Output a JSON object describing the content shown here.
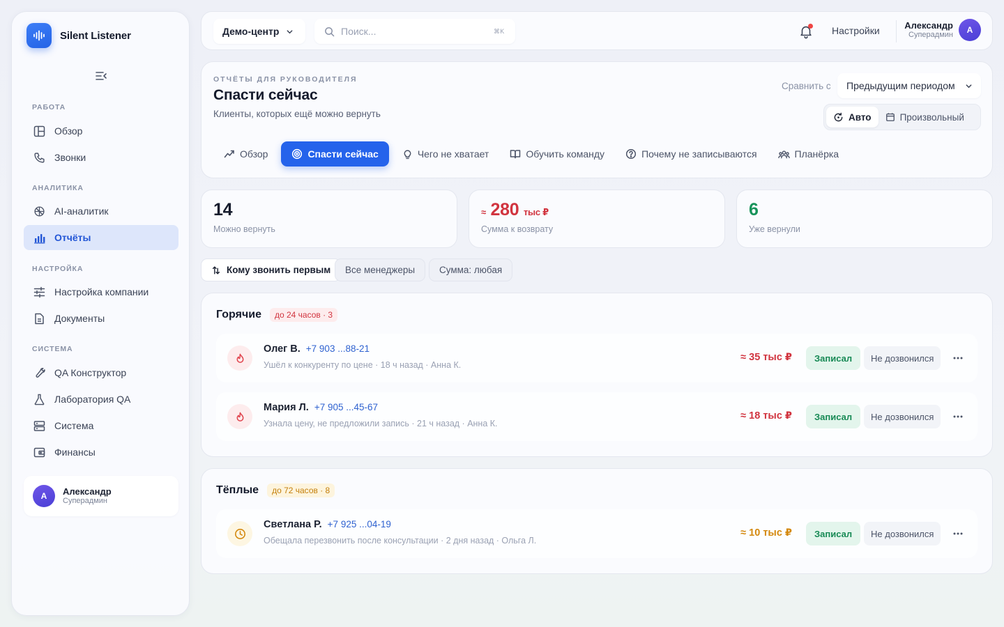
{
  "app": {
    "name": "Silent Listener"
  },
  "sidebar": {
    "sections": [
      {
        "title": "Работа",
        "items": [
          {
            "label": "Обзор",
            "icon": "layout-icon"
          },
          {
            "label": "Звонки",
            "icon": "phone-icon"
          }
        ]
      },
      {
        "title": "Аналитика",
        "items": [
          {
            "label": "AI-аналитик",
            "icon": "brain-icon"
          },
          {
            "label": "Отчёты",
            "icon": "bar-chart-icon",
            "active": true
          }
        ]
      },
      {
        "title": "Настройка",
        "items": [
          {
            "label": "Настройка компании",
            "icon": "sliders-icon"
          },
          {
            "label": "Документы",
            "icon": "document-icon"
          }
        ]
      },
      {
        "title": "Система",
        "items": [
          {
            "label": "QA Конструктор",
            "icon": "wrench-icon"
          },
          {
            "label": "Лаборатория QA",
            "icon": "flask-icon"
          },
          {
            "label": "Система",
            "icon": "server-icon"
          },
          {
            "label": "Финансы",
            "icon": "wallet-icon"
          }
        ]
      }
    ],
    "user": {
      "initial": "А",
      "name": "Александр",
      "role": "Суперадмин"
    }
  },
  "topbar": {
    "org": "Демо-центр",
    "search_placeholder": "Поиск...",
    "search_shortcut": "⌘K",
    "settings_label": "Настройки",
    "user": {
      "initial": "А",
      "name": "Александр",
      "role": "Суперадмин"
    },
    "notification_unread": true
  },
  "header": {
    "eyebrow": "Отчёты для руководителя",
    "title": "Спасти сейчас",
    "subtitle": "Клиенты, которых ещё можно вернуть",
    "compare_label": "Сравнить с",
    "compare_value": "Предыдущим периодом",
    "modes": [
      {
        "label": "Авто",
        "active": true
      },
      {
        "label": "Произвольный",
        "active": false
      }
    ],
    "tabs": [
      {
        "label": "Обзор",
        "icon": "trend-icon"
      },
      {
        "label": "Спасти сейчас",
        "icon": "target-icon",
        "active": true
      },
      {
        "label": "Чего не хватает",
        "icon": "bulb-icon"
      },
      {
        "label": "Обучить команду",
        "icon": "book-icon"
      },
      {
        "label": "Почему не записываются",
        "icon": "help-circle-icon"
      },
      {
        "label": "Планёрка",
        "icon": "team-icon"
      }
    ]
  },
  "stats": [
    {
      "value": "14",
      "label": "Можно вернуть",
      "color": "#161c2d"
    },
    {
      "prefix": "≈",
      "value": "280",
      "unit": "тыс ₽",
      "label": "Сумма к возврату",
      "color": "#d1343f"
    },
    {
      "value": "6",
      "label": "Уже вернули",
      "color": "#17935a"
    }
  ],
  "filters": [
    "Кому звонить первым",
    "Все менеджеры",
    "Сумма: любая"
  ],
  "groups": [
    {
      "title": "Горячие",
      "chip": "до 24 часов · 3",
      "kind": "hot",
      "rows": [
        {
          "name": "Олег В.",
          "phone": "+7 903 ...88-21",
          "meta": "Ушёл к конкуренту по цене · 18 ч назад · Анна К.",
          "sum": "≈ 35 тыс ₽",
          "ok": "Записал",
          "miss": "Не дозвонился"
        },
        {
          "name": "Мария Л.",
          "phone": "+7 905 ...45-67",
          "meta": "Узнала цену, не предложили запись · 21 ч назад · Анна К.",
          "sum": "≈ 18 тыс ₽",
          "ok": "Записал",
          "miss": "Не дозвонился"
        }
      ]
    },
    {
      "title": "Тёплые",
      "chip": "до 72 часов · 8",
      "kind": "warm",
      "rows": [
        {
          "name": "Светлана Р.",
          "phone": "+7 925 ...04-19",
          "meta": "Обещала перезвонить после консультации · 2 дня назад · Ольга Л.",
          "sum": "≈ 10 тыс ₽",
          "ok": "Записал",
          "miss": "Не дозвонился"
        }
      ]
    }
  ],
  "colors": {
    "accent": "#2563eb",
    "danger": "#d1343f",
    "success": "#17935a",
    "warning": "#d4890f"
  }
}
